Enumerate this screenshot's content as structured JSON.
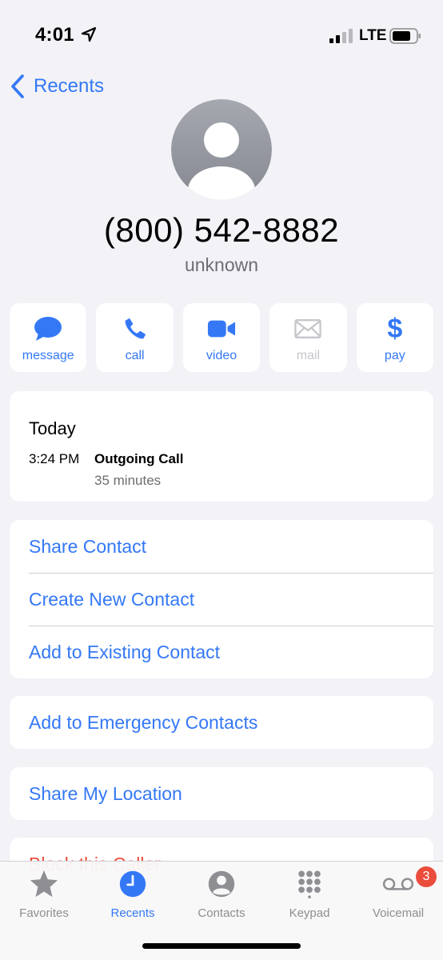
{
  "status_bar": {
    "time": "4:01",
    "network": "LTE"
  },
  "nav": {
    "back_label": "Recents"
  },
  "contact": {
    "phone_number": "(800) 542-8882",
    "label": "unknown"
  },
  "actions": [
    {
      "label": "message",
      "icon": "message-icon",
      "enabled": true
    },
    {
      "label": "call",
      "icon": "phone-icon",
      "enabled": true
    },
    {
      "label": "video",
      "icon": "video-camera-icon",
      "enabled": true
    },
    {
      "label": "mail",
      "icon": "mail-icon",
      "enabled": false
    },
    {
      "label": "pay",
      "icon": "dollar-icon",
      "enabled": true,
      "glyph": "$"
    }
  ],
  "history": {
    "date": "Today",
    "time": "3:24 PM",
    "type": "Outgoing Call",
    "duration": "35 minutes"
  },
  "contact_actions": [
    "Share Contact",
    "Create New Contact",
    "Add to Existing Contact"
  ],
  "emergency": {
    "label": "Add to Emergency Contacts"
  },
  "location": {
    "label": "Share My Location"
  },
  "block": {
    "label": "Block this Caller"
  },
  "tabs": [
    {
      "label": "Favorites",
      "icon": "star-icon",
      "active": false
    },
    {
      "label": "Recents",
      "icon": "clock-icon",
      "active": true
    },
    {
      "label": "Contacts",
      "icon": "person-circle-icon",
      "active": false
    },
    {
      "label": "Keypad",
      "icon": "keypad-icon",
      "active": false
    },
    {
      "label": "Voicemail",
      "icon": "voicemail-icon",
      "active": false
    }
  ],
  "voicemail_badge": "3",
  "colors": {
    "accent": "#3478f6",
    "destructive": "#eb4d3d",
    "background": "#f2f2f7",
    "inactive": "#8e8e93"
  }
}
